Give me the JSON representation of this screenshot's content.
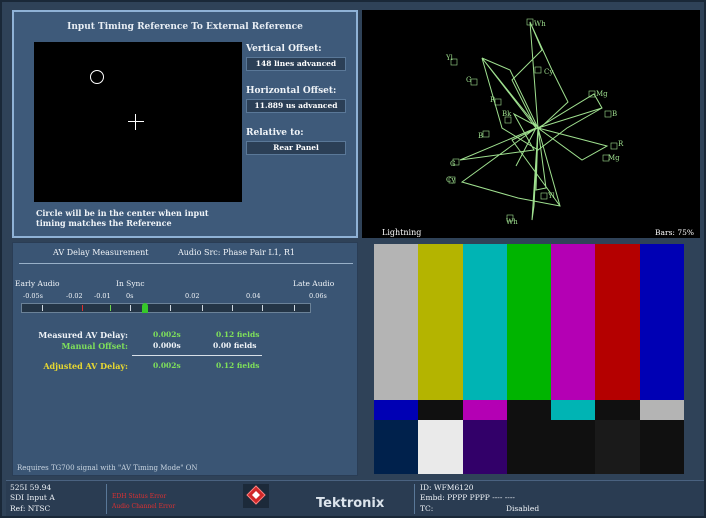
{
  "timing": {
    "title": "Input Timing Reference To External Reference",
    "vertical_offset_label": "Vertical Offset:",
    "vertical_offset_value": "148 lines advanced",
    "horizontal_offset_label": "Horizontal Offset:",
    "horizontal_offset_value": "11.889 us advanced",
    "relative_label": "Relative to:",
    "relative_value": "Rear Panel",
    "note_line1": "Circle will be in the center when input",
    "note_line2": "timing matches the Reference"
  },
  "lightning": {
    "mode_label": "Lightning",
    "bars_label": "Bars: 75%",
    "target_labels": [
      "Wh",
      "Yl",
      "Cy",
      "G",
      "Mg",
      "R",
      "B",
      "Bk",
      "B",
      "R",
      "Mg",
      "G",
      "Cy",
      "Yl",
      "Wh"
    ]
  },
  "av_delay": {
    "title": "AV Delay Measurement",
    "source": "Audio Src: Phase Pair  L1, R1",
    "early_label": "Early Audio",
    "sync_label": "In Sync",
    "late_label": "Late Audio",
    "ticks": [
      "-0.05s",
      "-0.02",
      "-0.01",
      "0s",
      "0.02",
      "0.04",
      "0.06s"
    ],
    "measured_label": "Measured AV Delay:",
    "measured_seconds": "0.002s",
    "measured_fields": "0.12 fields",
    "manual_label": "Manual Offset:",
    "manual_seconds": "0.000s",
    "manual_fields": "0.00 fields",
    "adjusted_label": "Adjusted AV Delay:",
    "adjusted_seconds": "0.002s",
    "adjusted_fields": "0.12 fields",
    "requirement_note": "Requires TG700 signal with \"AV Timing Mode\" ON"
  },
  "color_bars": {
    "bar_colors": [
      "#b4b4b4",
      "#b4b400",
      "#00b4b4",
      "#00b400",
      "#b400b4",
      "#b40000",
      "#0000b4"
    ],
    "castellation_colors": [
      "#0000b4",
      "#101010",
      "#b400b4",
      "#101010",
      "#00b4b4",
      "#101010",
      "#b4b4b4"
    ],
    "pluge_colors": [
      "#00214c",
      "#eaeaea",
      "#320069",
      "#101010",
      "#101010",
      "#1a1a1a",
      "#101010"
    ]
  },
  "status": {
    "line1": "525I 59.94",
    "line2": "SDI Input A",
    "line3": "Ref: NTSC",
    "alarm1": "EDH Status Error",
    "alarm2": "Audio Channel Error",
    "alarm_icon": "alarm-icon",
    "brand": "Tektronix",
    "id": "ID: WFM6120",
    "embd": "Embd: PPPP PPPP  ----  ----",
    "tc_label": "TC:",
    "tc_value": "Disabled"
  },
  "colors": {
    "trace": "#9fe08f",
    "needle": "#36c92a",
    "measured_value": "#7fe05a",
    "adjusted": "#e8d830",
    "alarm": "#e03030"
  }
}
